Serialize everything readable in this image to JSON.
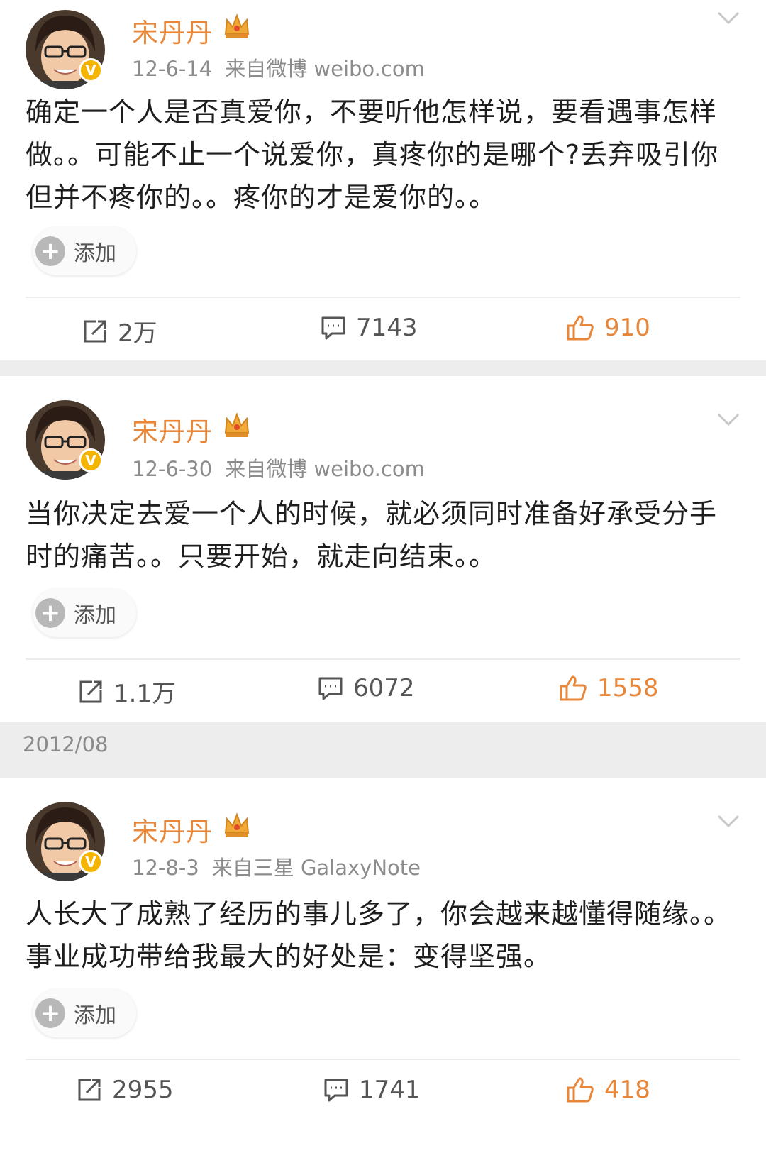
{
  "posts": [
    {
      "author": "宋丹丹",
      "date": "12-6-14",
      "source": "来自微博 weibo.com",
      "text": "确定一个人是否真爱你，不要听他怎样说，要看遇事怎样做。。可能不止一个说爱你，真疼你的是哪个?丢弃吸引你但并不疼你的。。疼你的才是爱你的。。",
      "add_label": "添加",
      "reposts": "2万",
      "comments": "7143",
      "likes": "910"
    },
    {
      "author": "宋丹丹",
      "date": "12-6-30",
      "source": "来自微博 weibo.com",
      "text": "当你决定去爱一个人的时候，就必须同时准备好承受分手时的痛苦。。只要开始，就走向结束。。",
      "add_label": "添加",
      "reposts": "1.1万",
      "comments": "6072",
      "likes": "1558"
    },
    {
      "author": "宋丹丹",
      "date": "12-8-3",
      "source": "来自三星 GalaxyNote",
      "text": "人长大了成熟了经历的事儿多了，你会越来越懂得随缘。。事业成功带给我最大的好处是：变得坚强。",
      "add_label": "添加",
      "reposts": "2955",
      "comments": "1741",
      "likes": "418"
    }
  ],
  "month_divider": "2012/08",
  "colors": {
    "accent": "#e8873a",
    "verified": "#f5b400",
    "meta_text": "#8c8c8c",
    "separator": "#ededed"
  },
  "icons": [
    "avatar",
    "verified-badge-icon",
    "crown-icon",
    "chevron-down-icon",
    "plus-icon",
    "repost-icon",
    "comment-icon",
    "like-icon"
  ]
}
